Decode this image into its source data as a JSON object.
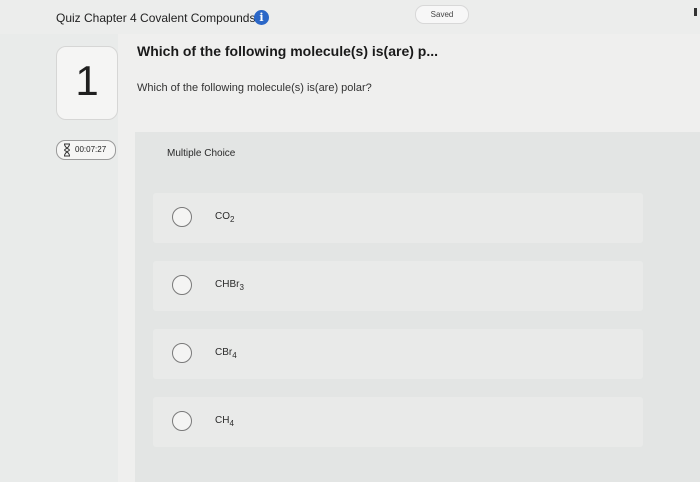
{
  "header": {
    "quiz_title": "Quiz Chapter 4 Covalent Compounds",
    "info_icon": "info-icon",
    "saved_label": "Saved"
  },
  "sidebar": {
    "question_number": "1",
    "timer": "00:07:27",
    "timer_icon": "hourglass-icon"
  },
  "question": {
    "heading": "Which of the following molecule(s) is(are) p...",
    "text": "Which of the following molecule(s) is(are) polar?"
  },
  "answer_section": {
    "type_label": "Multiple Choice",
    "options": [
      {
        "base": "CO",
        "sub": "2"
      },
      {
        "base": "CHBr",
        "sub": "3"
      },
      {
        "base": "CBr",
        "sub": "4"
      },
      {
        "base": "CH",
        "sub": "4"
      }
    ]
  },
  "colors": {
    "accent": "#2b67c7",
    "background": "#e9ebea"
  }
}
